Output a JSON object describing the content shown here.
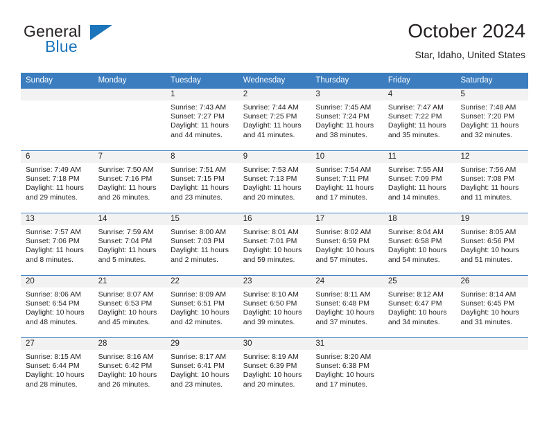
{
  "brand": {
    "name_part1": "General",
    "name_part2": "Blue",
    "logo_icon": "triangle-flag-icon",
    "accent_color": "#1b75bb"
  },
  "header": {
    "month_title": "October 2024",
    "location": "Star, Idaho, United States"
  },
  "calendar": {
    "header_color": "#3b7dbf",
    "day_band_color": "#f2f2f2",
    "weekdays": [
      "Sunday",
      "Monday",
      "Tuesday",
      "Wednesday",
      "Thursday",
      "Friday",
      "Saturday"
    ],
    "labels": {
      "sunrise": "Sunrise:",
      "sunset": "Sunset:",
      "daylight": "Daylight:"
    },
    "weeks": [
      [
        {
          "day": "",
          "empty": true
        },
        {
          "day": "",
          "empty": true
        },
        {
          "day": "1",
          "sunrise": "Sunrise: 7:43 AM",
          "sunset": "Sunset: 7:27 PM",
          "daylight_l1": "Daylight: 11 hours",
          "daylight_l2": "and 44 minutes."
        },
        {
          "day": "2",
          "sunrise": "Sunrise: 7:44 AM",
          "sunset": "Sunset: 7:25 PM",
          "daylight_l1": "Daylight: 11 hours",
          "daylight_l2": "and 41 minutes."
        },
        {
          "day": "3",
          "sunrise": "Sunrise: 7:45 AM",
          "sunset": "Sunset: 7:24 PM",
          "daylight_l1": "Daylight: 11 hours",
          "daylight_l2": "and 38 minutes."
        },
        {
          "day": "4",
          "sunrise": "Sunrise: 7:47 AM",
          "sunset": "Sunset: 7:22 PM",
          "daylight_l1": "Daylight: 11 hours",
          "daylight_l2": "and 35 minutes."
        },
        {
          "day": "5",
          "sunrise": "Sunrise: 7:48 AM",
          "sunset": "Sunset: 7:20 PM",
          "daylight_l1": "Daylight: 11 hours",
          "daylight_l2": "and 32 minutes."
        }
      ],
      [
        {
          "day": "6",
          "sunrise": "Sunrise: 7:49 AM",
          "sunset": "Sunset: 7:18 PM",
          "daylight_l1": "Daylight: 11 hours",
          "daylight_l2": "and 29 minutes."
        },
        {
          "day": "7",
          "sunrise": "Sunrise: 7:50 AM",
          "sunset": "Sunset: 7:16 PM",
          "daylight_l1": "Daylight: 11 hours",
          "daylight_l2": "and 26 minutes."
        },
        {
          "day": "8",
          "sunrise": "Sunrise: 7:51 AM",
          "sunset": "Sunset: 7:15 PM",
          "daylight_l1": "Daylight: 11 hours",
          "daylight_l2": "and 23 minutes."
        },
        {
          "day": "9",
          "sunrise": "Sunrise: 7:53 AM",
          "sunset": "Sunset: 7:13 PM",
          "daylight_l1": "Daylight: 11 hours",
          "daylight_l2": "and 20 minutes."
        },
        {
          "day": "10",
          "sunrise": "Sunrise: 7:54 AM",
          "sunset": "Sunset: 7:11 PM",
          "daylight_l1": "Daylight: 11 hours",
          "daylight_l2": "and 17 minutes."
        },
        {
          "day": "11",
          "sunrise": "Sunrise: 7:55 AM",
          "sunset": "Sunset: 7:09 PM",
          "daylight_l1": "Daylight: 11 hours",
          "daylight_l2": "and 14 minutes."
        },
        {
          "day": "12",
          "sunrise": "Sunrise: 7:56 AM",
          "sunset": "Sunset: 7:08 PM",
          "daylight_l1": "Daylight: 11 hours",
          "daylight_l2": "and 11 minutes."
        }
      ],
      [
        {
          "day": "13",
          "sunrise": "Sunrise: 7:57 AM",
          "sunset": "Sunset: 7:06 PM",
          "daylight_l1": "Daylight: 11 hours",
          "daylight_l2": "and 8 minutes."
        },
        {
          "day": "14",
          "sunrise": "Sunrise: 7:59 AM",
          "sunset": "Sunset: 7:04 PM",
          "daylight_l1": "Daylight: 11 hours",
          "daylight_l2": "and 5 minutes."
        },
        {
          "day": "15",
          "sunrise": "Sunrise: 8:00 AM",
          "sunset": "Sunset: 7:03 PM",
          "daylight_l1": "Daylight: 11 hours",
          "daylight_l2": "and 2 minutes."
        },
        {
          "day": "16",
          "sunrise": "Sunrise: 8:01 AM",
          "sunset": "Sunset: 7:01 PM",
          "daylight_l1": "Daylight: 10 hours",
          "daylight_l2": "and 59 minutes."
        },
        {
          "day": "17",
          "sunrise": "Sunrise: 8:02 AM",
          "sunset": "Sunset: 6:59 PM",
          "daylight_l1": "Daylight: 10 hours",
          "daylight_l2": "and 57 minutes."
        },
        {
          "day": "18",
          "sunrise": "Sunrise: 8:04 AM",
          "sunset": "Sunset: 6:58 PM",
          "daylight_l1": "Daylight: 10 hours",
          "daylight_l2": "and 54 minutes."
        },
        {
          "day": "19",
          "sunrise": "Sunrise: 8:05 AM",
          "sunset": "Sunset: 6:56 PM",
          "daylight_l1": "Daylight: 10 hours",
          "daylight_l2": "and 51 minutes."
        }
      ],
      [
        {
          "day": "20",
          "sunrise": "Sunrise: 8:06 AM",
          "sunset": "Sunset: 6:54 PM",
          "daylight_l1": "Daylight: 10 hours",
          "daylight_l2": "and 48 minutes."
        },
        {
          "day": "21",
          "sunrise": "Sunrise: 8:07 AM",
          "sunset": "Sunset: 6:53 PM",
          "daylight_l1": "Daylight: 10 hours",
          "daylight_l2": "and 45 minutes."
        },
        {
          "day": "22",
          "sunrise": "Sunrise: 8:09 AM",
          "sunset": "Sunset: 6:51 PM",
          "daylight_l1": "Daylight: 10 hours",
          "daylight_l2": "and 42 minutes."
        },
        {
          "day": "23",
          "sunrise": "Sunrise: 8:10 AM",
          "sunset": "Sunset: 6:50 PM",
          "daylight_l1": "Daylight: 10 hours",
          "daylight_l2": "and 39 minutes."
        },
        {
          "day": "24",
          "sunrise": "Sunrise: 8:11 AM",
          "sunset": "Sunset: 6:48 PM",
          "daylight_l1": "Daylight: 10 hours",
          "daylight_l2": "and 37 minutes."
        },
        {
          "day": "25",
          "sunrise": "Sunrise: 8:12 AM",
          "sunset": "Sunset: 6:47 PM",
          "daylight_l1": "Daylight: 10 hours",
          "daylight_l2": "and 34 minutes."
        },
        {
          "day": "26",
          "sunrise": "Sunrise: 8:14 AM",
          "sunset": "Sunset: 6:45 PM",
          "daylight_l1": "Daylight: 10 hours",
          "daylight_l2": "and 31 minutes."
        }
      ],
      [
        {
          "day": "27",
          "sunrise": "Sunrise: 8:15 AM",
          "sunset": "Sunset: 6:44 PM",
          "daylight_l1": "Daylight: 10 hours",
          "daylight_l2": "and 28 minutes."
        },
        {
          "day": "28",
          "sunrise": "Sunrise: 8:16 AM",
          "sunset": "Sunset: 6:42 PM",
          "daylight_l1": "Daylight: 10 hours",
          "daylight_l2": "and 26 minutes."
        },
        {
          "day": "29",
          "sunrise": "Sunrise: 8:17 AM",
          "sunset": "Sunset: 6:41 PM",
          "daylight_l1": "Daylight: 10 hours",
          "daylight_l2": "and 23 minutes."
        },
        {
          "day": "30",
          "sunrise": "Sunrise: 8:19 AM",
          "sunset": "Sunset: 6:39 PM",
          "daylight_l1": "Daylight: 10 hours",
          "daylight_l2": "and 20 minutes."
        },
        {
          "day": "31",
          "sunrise": "Sunrise: 8:20 AM",
          "sunset": "Sunset: 6:38 PM",
          "daylight_l1": "Daylight: 10 hours",
          "daylight_l2": "and 17 minutes."
        },
        {
          "day": "",
          "empty": true
        },
        {
          "day": "",
          "empty": true
        }
      ]
    ]
  }
}
